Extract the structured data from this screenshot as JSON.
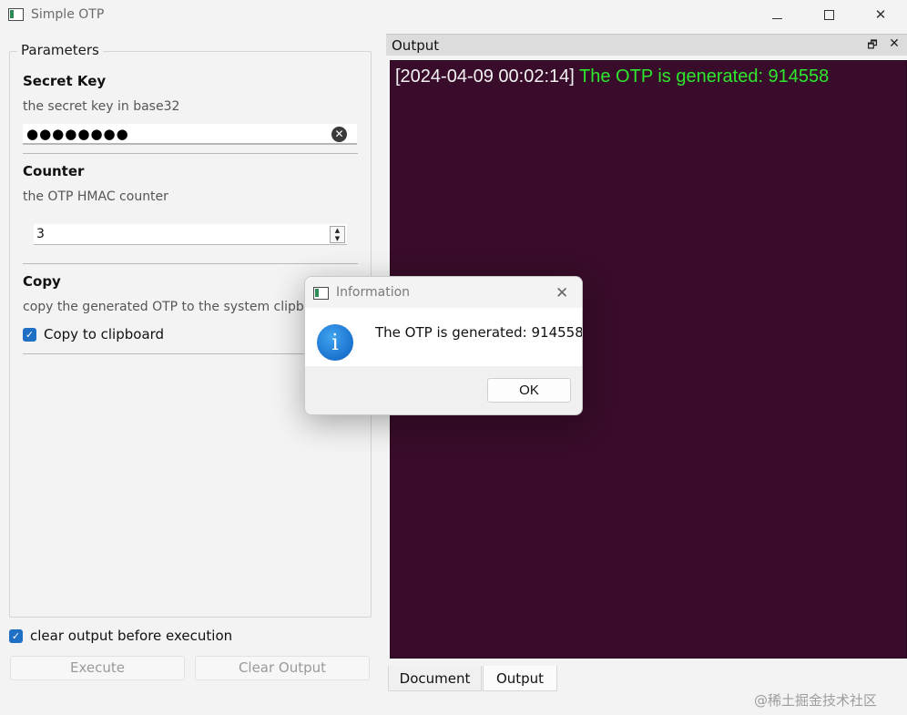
{
  "window": {
    "title": "Simple OTP",
    "controls": {
      "minimize": "",
      "maximize": "",
      "close": "✕"
    }
  },
  "parameters": {
    "legend": "Parameters",
    "secret_key": {
      "title": "Secret Key",
      "description": "the secret key in base32",
      "value": "●●●●●●●●",
      "clear_icon": "✕"
    },
    "counter": {
      "title": "Counter",
      "description": "the OTP HMAC counter",
      "value": "3",
      "up_arrow": "▲",
      "down_arrow": "▼"
    },
    "copy": {
      "title": "Copy",
      "description": "copy the generated OTP to the system clipboard",
      "checkbox_label": "Copy to clipboard",
      "checked": true
    }
  },
  "bottom": {
    "clear_before_label": "clear output before execution",
    "clear_before_checked": true,
    "execute_label": "Execute",
    "clear_output_label": "Clear Output"
  },
  "output_dock": {
    "title": "Output",
    "float_icon": "🗗",
    "close_icon": "✕",
    "log": {
      "timestamp": "[2024-04-09 00:02:14]",
      "message": "The OTP is generated: 914558"
    },
    "colors": {
      "background": "#380c2a",
      "timestamp": "#f2f2f2",
      "message": "#2ee82e"
    },
    "tabs": [
      "Document",
      "Output"
    ],
    "active_tab": "Output"
  },
  "dialog": {
    "title": "Information",
    "close_icon": "✕",
    "icon_glyph": "i",
    "message": "The OTP is generated: 914558",
    "ok_label": "OK"
  },
  "watermark": "@稀土掘金技术社区",
  "check_glyph": "✓"
}
